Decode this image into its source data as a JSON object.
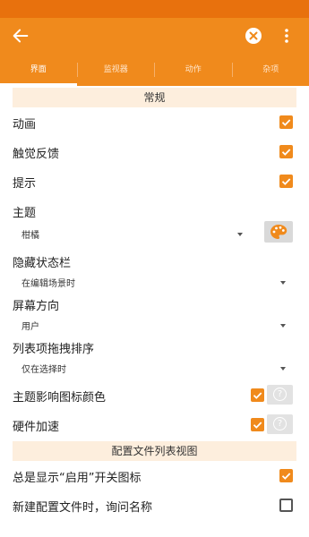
{
  "tabs": [
    {
      "label": "界面",
      "active": true
    },
    {
      "label": "监视器",
      "active": false
    },
    {
      "label": "动作",
      "active": false
    },
    {
      "label": "杂项",
      "active": false
    }
  ],
  "sections": {
    "general": "常规",
    "profile_list_view": "配置文件列表视图"
  },
  "prefs": {
    "animation": {
      "label": "动画",
      "checked": true
    },
    "haptic": {
      "label": "触觉反馈",
      "checked": true
    },
    "hints": {
      "label": "提示",
      "checked": true
    },
    "theme": {
      "label": "主题",
      "value": "柑橘"
    },
    "hide_status_bar": {
      "label": "隐藏状态栏",
      "value": "在编辑场景时"
    },
    "screen_orientation": {
      "label": "屏幕方向",
      "value": "用户"
    },
    "drag_sort": {
      "label": "列表项拖拽排序",
      "value": "仅在选择时"
    },
    "theme_icon_color": {
      "label": "主题影响图标颜色",
      "checked": true
    },
    "hw_accel": {
      "label": "硬件加速",
      "checked": true
    },
    "show_enable_switch": {
      "label": "总是显示“启用”开关图标",
      "checked": true
    },
    "ask_name": {
      "label": "新建配置文件时，询问名称",
      "checked": false
    }
  },
  "icons": {
    "back": "arrow-left-icon",
    "clear": "clear-circle-icon",
    "more": "more-vertical-icon",
    "palette": "palette-icon",
    "help": "help-circle-icon",
    "dropdown": "dropdown-arrow-icon"
  },
  "colors": {
    "accent": "#f08a1c",
    "status_bar": "#e8710d",
    "section_bg": "#fdeedd"
  }
}
